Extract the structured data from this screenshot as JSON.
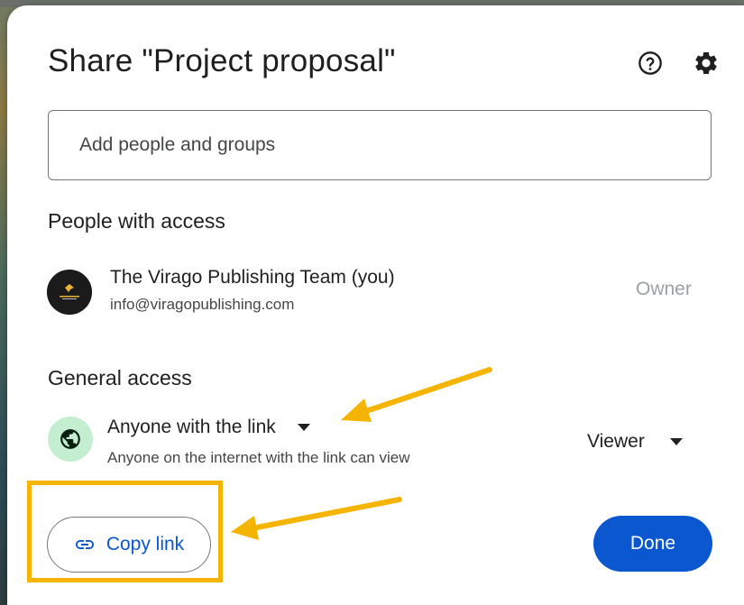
{
  "dialog": {
    "title": "Share \"Project proposal\"",
    "help_icon": "help-circle-icon",
    "settings_icon": "gear-icon"
  },
  "add_people": {
    "placeholder": "Add people and groups",
    "value": ""
  },
  "people_with_access": {
    "heading": "People with access",
    "people": [
      {
        "name": "The Virago Publishing Team (you)",
        "email": "info@viragopublishing.com",
        "role": "Owner"
      }
    ]
  },
  "general_access": {
    "heading": "General access",
    "icon": "globe-icon",
    "selected_access": "Anyone with the link",
    "description": "Anyone on the internet with the link can view",
    "selected_role": "Viewer"
  },
  "footer": {
    "copy_link_label": "Copy link",
    "copy_link_icon": "link-icon",
    "done_label": "Done"
  },
  "annotations": {
    "highlight_color": "#f4b400",
    "arrow_color": "#f4b400"
  },
  "colors": {
    "accent": "#0b57d0",
    "globe_bg": "#c4eed0",
    "owner_text": "#9aa0a6"
  }
}
